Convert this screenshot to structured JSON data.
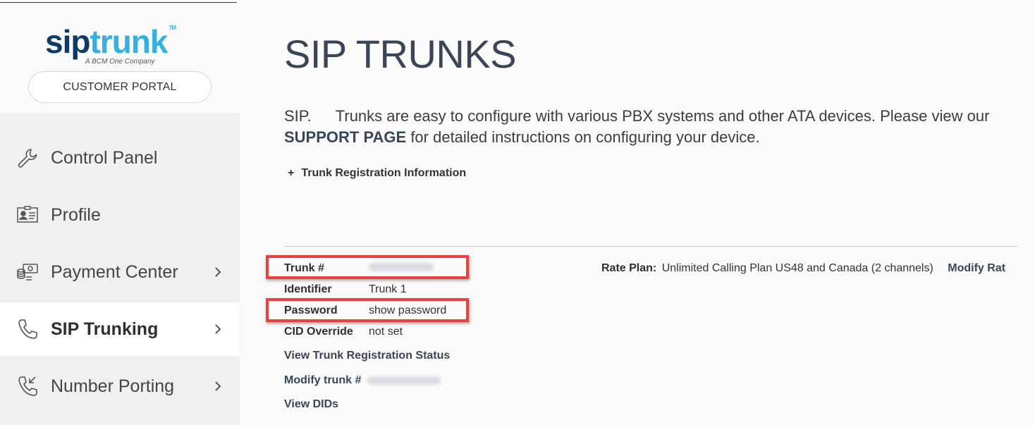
{
  "brand": {
    "logo_sip": "sip",
    "logo_trunk": "trunk",
    "logo_tm": "TM",
    "tagline": "A BCM One Company",
    "portal_button": "CUSTOMER PORTAL"
  },
  "nav": {
    "items": [
      {
        "label": "Control Panel",
        "icon": "wrench-icon",
        "active": false,
        "has_chevron": false
      },
      {
        "label": "Profile",
        "icon": "id-card-icon",
        "active": false,
        "has_chevron": false
      },
      {
        "label": "Payment Center",
        "icon": "coins-icon",
        "active": false,
        "has_chevron": true
      },
      {
        "label": "SIP Trunking",
        "icon": "phone-icon",
        "active": true,
        "has_chevron": true
      },
      {
        "label": "Number Porting",
        "icon": "phone-incoming-icon",
        "active": false,
        "has_chevron": true
      }
    ]
  },
  "main": {
    "title": "SIP TRUNKS",
    "intro_start": "SIP.",
    "intro_mid": "Trunks are easy to configure with various PBX systems and other ATA devices. Please view our",
    "intro_link": "SUPPORT PAGE",
    "intro_end": "for detailed instructions on configuring your device.",
    "reg_toggle_symbol": "+",
    "reg_toggle_label": "Trunk Registration Information",
    "details": {
      "trunk_label": "Trunk #",
      "identifier_label": "Identifier",
      "identifier_value": "Trunk 1",
      "password_label": "Password",
      "password_value": "show password",
      "cid_label": "CID Override",
      "cid_value": "not set"
    },
    "links": {
      "view_status": "View Trunk Registration Status",
      "modify_trunk": "Modify trunk #",
      "view_dids": "View DIDs"
    },
    "rate": {
      "label": "Rate Plan:",
      "value": "Unlimited Calling Plan US48 and Canada (2 channels)",
      "modify": "Modify Rat"
    }
  },
  "colors": {
    "accent_dark": "#0e3b63",
    "accent_light": "#36b0e0",
    "highlight": "#e8413f",
    "heading": "#3a4657"
  }
}
